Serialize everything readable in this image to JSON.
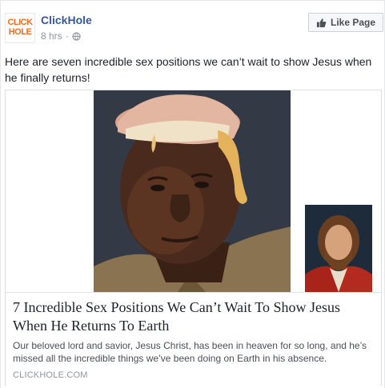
{
  "post": {
    "page_name": "ClickHole",
    "logo_text": "CLICK HOLE",
    "time": "8 hrs",
    "separator": "·",
    "privacy_icon": "globe-icon",
    "like_button_label": "Like Page",
    "like_icon": "thumbs-up-icon",
    "caption": "Here are seven incredible sex positions we can’t wait to show Jesus when he finally returns!"
  },
  "link_preview": {
    "title": "7 Incredible Sex Positions We Can’t Wait To Show Jesus When He Returns To Earth",
    "description": "Our beloved lord and savior, Jesus Christ, has been in heaven for so long, and he’s missed all the incredible things we’ve been doing on Earth in his absence.",
    "domain": "CLICKHOLE.COM"
  },
  "colors": {
    "link_blue": "#365899",
    "brand_orange": "#f26a1b",
    "meta_gray": "#90949c",
    "text_dark": "#1d2129"
  }
}
